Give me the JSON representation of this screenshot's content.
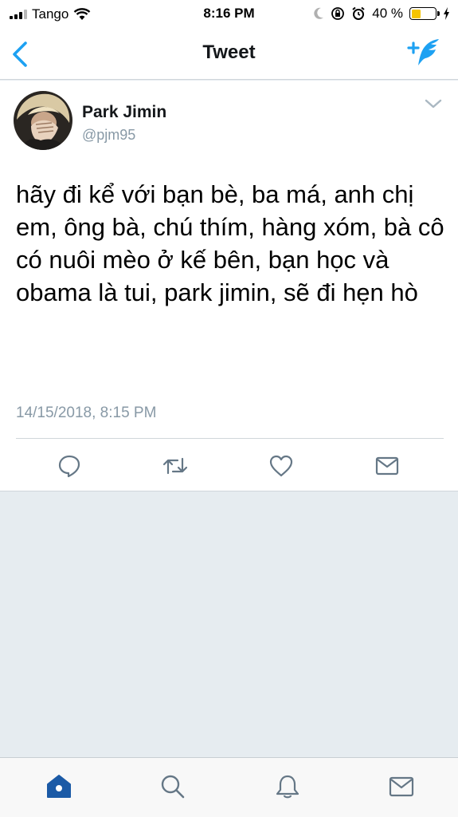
{
  "status_bar": {
    "carrier": "Tango",
    "time": "8:16 PM",
    "battery_percent": "40 %",
    "battery_level": 0.4
  },
  "nav": {
    "title": "Tweet",
    "back_icon": "chevron-left-icon",
    "compose_icon": "compose-tweet-icon"
  },
  "tweet": {
    "author_name": "Park Jimin",
    "author_handle": "@pjm95",
    "text": "hãy đi kể với bạn bè, ba má, anh chị em, ông bà, chú thím, hàng xóm, bà cô có nuôi mèo ở kế bên, bạn học và obama là tui, park jimin, sẽ đi hẹn hò",
    "timestamp": "14/15/2018, 8:15 PM",
    "actions": [
      "reply-icon",
      "retweet-icon",
      "like-icon",
      "direct-message-icon"
    ]
  },
  "tab_bar": {
    "items": [
      "home-icon",
      "search-icon",
      "notifications-icon",
      "messages-icon"
    ],
    "active": "home-icon"
  },
  "colors": {
    "accent": "#1da1f2",
    "active_tab": "#1b5aa6",
    "icon_gray": "#657786",
    "secondary_text": "#8899a6"
  }
}
